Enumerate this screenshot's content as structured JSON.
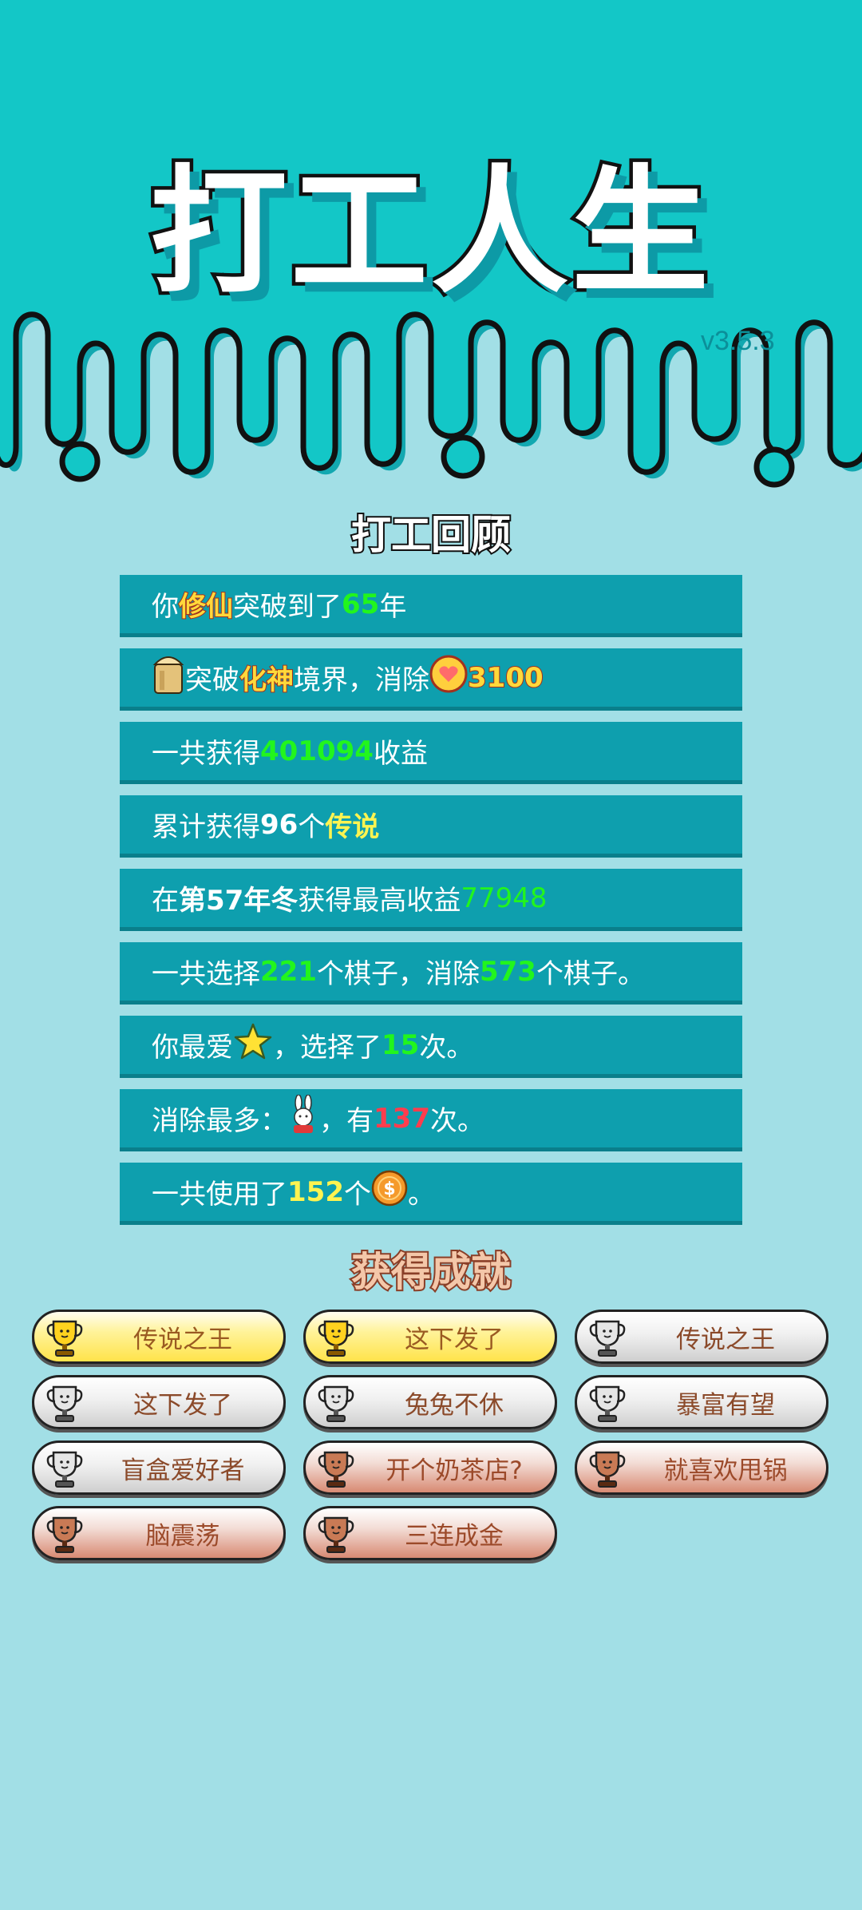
{
  "header": {
    "title": "打工人生",
    "version": "v3.5.3"
  },
  "review": {
    "heading": "打工回顾",
    "lines": [
      {
        "a": "你 ",
        "b": "修仙",
        "c": "突破到了",
        "d": "65",
        "e": "年"
      },
      {
        "a": "突破",
        "b": "化神",
        "c": "境界，消除",
        "d": "3100"
      },
      {
        "a": "一共获得",
        "b": "401094",
        "c": "收益"
      },
      {
        "a": "累计获得",
        "b": "96",
        "c": "个",
        "d": "传说"
      },
      {
        "a": "在 ",
        "b": "第57年冬",
        "c": " 获得最高收益",
        "d": "77948"
      },
      {
        "a": "一共选择",
        "b": "221",
        "c": "个棋子，消除",
        "d": "573",
        "e": "个棋子。"
      },
      {
        "a": "你最爱",
        "b": "，选择了",
        "c": "15",
        "d": "次。"
      },
      {
        "a": "消除最多：",
        "b": "，有",
        "c": "137",
        "d": "次。"
      },
      {
        "a": "一共使用了",
        "b": "152",
        "c": "个",
        "d": "。"
      }
    ]
  },
  "achievements": {
    "heading": "获得成就",
    "items": [
      {
        "label": "传说之王",
        "tier": "gold"
      },
      {
        "label": "这下发了",
        "tier": "gold"
      },
      {
        "label": "传说之王",
        "tier": "silver"
      },
      {
        "label": "这下发了",
        "tier": "silver"
      },
      {
        "label": "兔兔不休",
        "tier": "silver"
      },
      {
        "label": "暴富有望",
        "tier": "silver"
      },
      {
        "label": "盲盒爱好者",
        "tier": "silver"
      },
      {
        "label": "开个奶茶店?",
        "tier": "bronze"
      },
      {
        "label": "就喜欢甩锅",
        "tier": "bronze"
      },
      {
        "label": "脑震荡",
        "tier": "bronze"
      },
      {
        "label": "三连成金",
        "tier": "bronze"
      }
    ]
  },
  "colors": {
    "header_bg": "#13c7c7",
    "page_bg": "#a2dfe6",
    "panel_bg": "#0e9fae",
    "highlight_green": "#22f51d",
    "highlight_yellow": "#fff23b",
    "highlight_red": "#ff3d4d"
  },
  "icons": {
    "level": "bucket-icon",
    "heart_coin": "heart-coin-icon",
    "favorite": "star-icon",
    "most_removed": "rabbit-icon",
    "coin": "dollar-coin-icon",
    "trophy": "trophy-icon"
  }
}
